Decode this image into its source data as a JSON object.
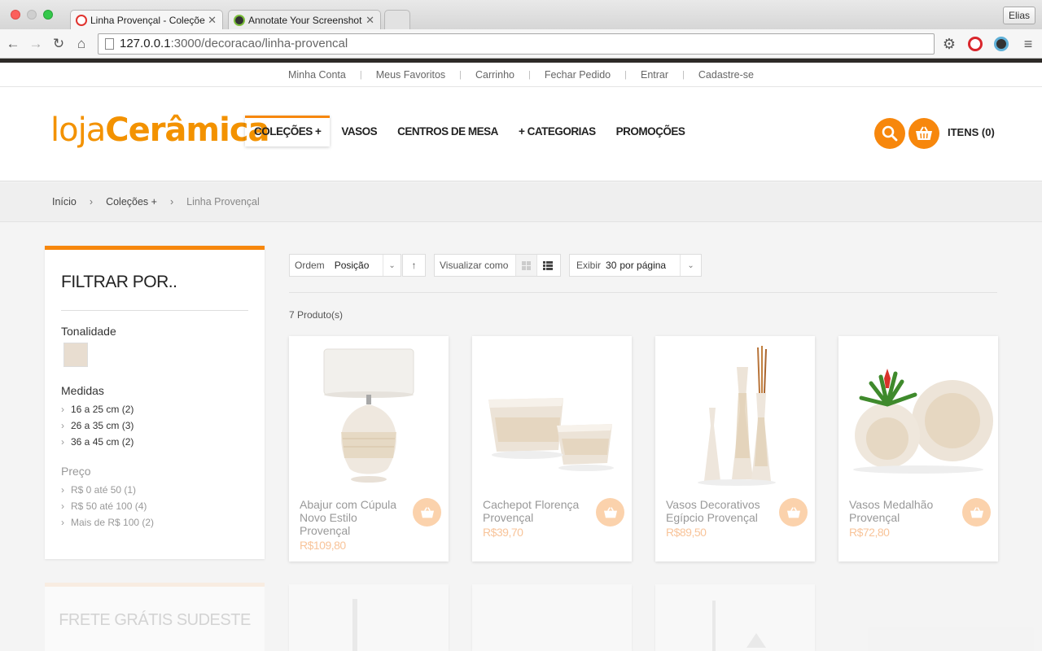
{
  "browser": {
    "tabs": [
      {
        "title": "Linha Provençal - Coleçõe",
        "active": true
      },
      {
        "title": "Annotate Your Screenshot",
        "active": false
      }
    ],
    "user": "Elias",
    "url_host": "127.0.0.1",
    "url_path": ":3000/decoracao/linha-provencal",
    "icons": [
      "back-icon",
      "forward-icon",
      "reload-icon",
      "home-icon",
      "gear-icon",
      "stop-icon",
      "extension-icon",
      "menu-icon"
    ]
  },
  "toplinks": [
    "Minha Conta",
    "Meus Favoritos",
    "Carrinho",
    "Fechar Pedido",
    "Entrar",
    "Cadastre-se"
  ],
  "logo": {
    "part1": "loja",
    "part2": "Cerâmica"
  },
  "nav": [
    "COLEÇÕES +",
    "VASOS",
    "CENTROS DE MESA",
    "+ CATEGORIAS",
    "PROMOÇÕES"
  ],
  "cart": {
    "label": "ITENS (0)"
  },
  "breadcrumb": {
    "home": "Início",
    "parent": "Coleções +",
    "current": "Linha Provençal"
  },
  "filters": {
    "title": "FILTRAR POR..",
    "tonalidade": {
      "title": "Tonalidade",
      "swatch_color": "#e8ddd0"
    },
    "medidas": {
      "title": "Medidas",
      "items": [
        "16 a 25 cm (2)",
        "26 a 35 cm (3)",
        "36 a 45 cm (2)"
      ]
    },
    "preco": {
      "title": "Preço",
      "items": [
        "R$ 0 até 50 (1)",
        "R$ 50 até 100 (4)",
        "Mais de R$ 100 (2)"
      ]
    }
  },
  "promo": "FRETE GRÁTIS SUDESTE",
  "sorting": {
    "order_label": "Ordem",
    "order_value": "Posição",
    "view_label": "Visualizar como",
    "show_label": "Exibir",
    "show_value": "30",
    "show_suffix": "por página"
  },
  "product_count": "7 Produto(s)",
  "products": [
    {
      "name": "Abajur com Cúpula Novo Estilo Provençal",
      "price": "R$109,80"
    },
    {
      "name": "Cachepot Florença Provençal",
      "price": "R$39,70"
    },
    {
      "name": "Vasos Decorativos Egípcio Provençal",
      "price": "R$89,50"
    },
    {
      "name": "Vasos Medalhão Provençal",
      "price": "R$72,80"
    }
  ],
  "colors": {
    "accent": "#f7870c",
    "price": "#f8c49a"
  }
}
